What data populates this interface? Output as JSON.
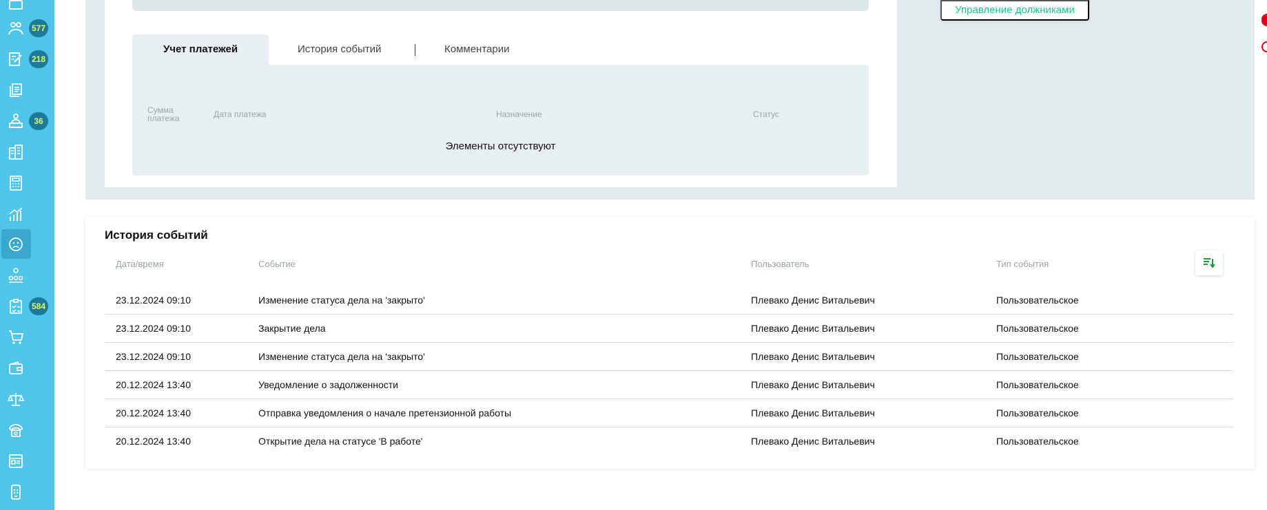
{
  "sidebar": {
    "items": [
      {
        "icon": "handshake-people-icon",
        "badge": "577"
      },
      {
        "icon": "document-edit-icon",
        "badge": "218"
      },
      {
        "icon": "documents-stack-icon",
        "badge": ""
      },
      {
        "icon": "person-desk-icon",
        "badge": "36"
      },
      {
        "icon": "buildings-icon",
        "badge": ""
      },
      {
        "icon": "calculator-icon",
        "badge": ""
      },
      {
        "icon": "growth-chart-icon",
        "badge": ""
      },
      {
        "icon": "sad-face-icon",
        "badge": "",
        "active": true
      },
      {
        "icon": "org-structure-icon",
        "badge": ""
      },
      {
        "icon": "clipboard-checklist-icon",
        "badge": "584"
      },
      {
        "icon": "shopping-cart-icon",
        "badge": ""
      },
      {
        "icon": "wallet-icon",
        "badge": ""
      },
      {
        "icon": "scales-icon",
        "badge": ""
      },
      {
        "icon": "phone-icon",
        "badge": ""
      },
      {
        "icon": "id-card-icon",
        "badge": ""
      },
      {
        "icon": "mobile-app-icon",
        "badge": ""
      }
    ]
  },
  "debtor_management_button": "Управление должниками",
  "tabs": [
    {
      "label": "Учет платежей",
      "active": true
    },
    {
      "label": "История событий",
      "active": false
    },
    {
      "label": "Комментарии",
      "active": false
    }
  ],
  "payments": {
    "headers": {
      "amount": "Сумма платежа",
      "date": "Дата платежа",
      "purpose": "Назначение",
      "status": "Статус"
    },
    "empty_message": "Элементы отсутствуют"
  },
  "events": {
    "title": "История событий",
    "headers": {
      "datetime": "Дата/время",
      "event": "Событие",
      "user": "Пользователь",
      "type": "Тип события"
    },
    "sort_icon": "sort-descending-icon",
    "rows": [
      {
        "datetime": "23.12.2024 09:10",
        "event": "Изменение статуса дела на 'закрыто'",
        "user": "Плевако Денис Витальевич",
        "type": "Пользовательское"
      },
      {
        "datetime": "23.12.2024 09:10",
        "event": "Закрытие дела",
        "user": "Плевако Денис Витальевич",
        "type": "Пользовательское"
      },
      {
        "datetime": "23.12.2024 09:10",
        "event": "Изменение статуса дела на 'закрыто'",
        "user": "Плевако Денис Витальевич",
        "type": "Пользовательское"
      },
      {
        "datetime": "20.12.2024 13:40",
        "event": "Уведомление о задолженности",
        "user": "Плевако Денис Витальевич",
        "type": "Пользовательское"
      },
      {
        "datetime": "20.12.2024 13:40",
        "event": "Отправка уведомления о начале претензионной работы",
        "user": "Плевако Денис Витальевич",
        "type": "Пользовательское"
      },
      {
        "datetime": "20.12.2024 13:40",
        "event": "Открытие дела на статусе 'В работе'",
        "user": "Плевако Денис Витальевич",
        "type": "Пользовательское"
      }
    ]
  },
  "colors": {
    "sidebar": "#4ec5e9",
    "badge_bg": "#1d7a98",
    "badge_text": "#d8ff57",
    "accent_green": "#18c88b",
    "panel_bg": "#e7eff1"
  }
}
